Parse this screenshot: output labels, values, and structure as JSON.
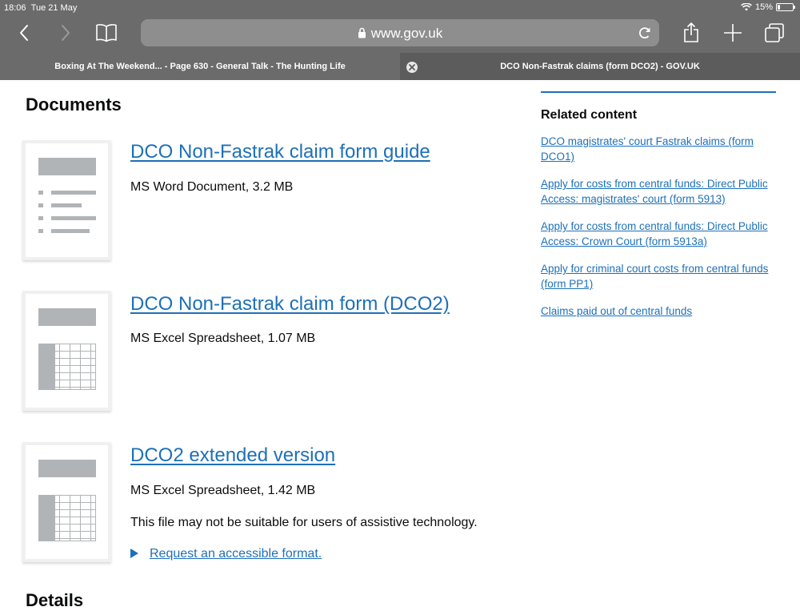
{
  "status_bar": {
    "time": "18:06",
    "date": "Tue 21 May",
    "battery": "15%",
    "battery_level": 0.15
  },
  "browser": {
    "address": "www.gov.uk",
    "tabs": [
      {
        "label": "Boxing At The Weekend... - Page 630 - General Talk - The Hunting Life",
        "active": false
      },
      {
        "label": "DCO Non-Fastrak claims (form DCO2) - GOV.UK",
        "active": true
      }
    ],
    "icons": {
      "back": "chevron-left-icon",
      "forward": "chevron-right-icon",
      "bookmarks": "book-icon",
      "reload": "reload-icon",
      "share": "share-icon",
      "new_tab": "plus-icon",
      "tabs": "tabs-icon",
      "lock": "lock-icon",
      "close_tab": "close-icon"
    }
  },
  "page": {
    "documents_heading": "Documents",
    "documents": [
      {
        "title": "DCO Non-Fastrak claim form guide",
        "meta": "MS Word Document, 3.2 MB",
        "thumbnail": "word-document-icon"
      },
      {
        "title": "DCO Non-Fastrak claim form (DCO2)",
        "meta": "MS Excel Spreadsheet, 1.07 MB",
        "thumbnail": "spreadsheet-icon"
      },
      {
        "title": "DCO2 extended version",
        "meta": "MS Excel Spreadsheet, 1.42 MB",
        "notice": "This file may not be suitable for users of assistive technology.",
        "request_link": "Request an accessible format.",
        "thumbnail": "spreadsheet-icon"
      }
    ],
    "details_heading": "Details",
    "related": {
      "title": "Related content",
      "links": [
        "DCO magistrates' court Fastrak claims (form DCO1)",
        "Apply for costs from central funds: Direct Public Access: magistrates' court (form 5913)",
        "Apply for costs from central funds: Direct Public Access: Crown Court (form 5913a)",
        "Apply for criminal court costs from central funds (form PP1)",
        "Claims paid out of central funds"
      ]
    }
  },
  "colors": {
    "chrome": "#6b6b6b",
    "link": "#1d70b8",
    "text": "#0b0c0c",
    "thumbnail_grey": "#b1b4b6"
  }
}
